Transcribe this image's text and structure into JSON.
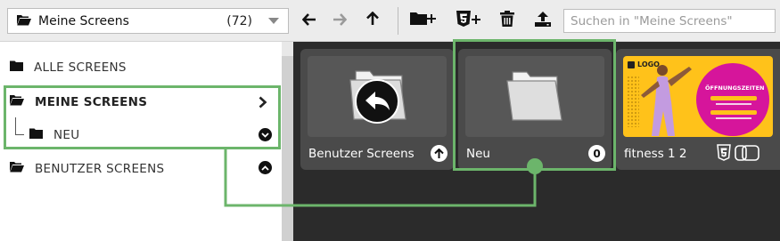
{
  "toolbar": {
    "folder_select": {
      "label": "Meine Screens",
      "count": "(72)"
    },
    "buttons": {
      "back": "arrow-left-icon",
      "forward": "arrow-right-icon",
      "up": "arrow-up-icon",
      "new_folder": "folder-plus-icon",
      "new_html5": "html5-plus-icon",
      "delete": "trash-icon",
      "upload": "upload-icon"
    },
    "search": {
      "placeholder": "Suchen in \"Meine Screens\"",
      "value": ""
    }
  },
  "sidebar": {
    "items": [
      {
        "label": "ALLE SCREENS"
      },
      {
        "label": "MEINE SCREENS"
      },
      {
        "label": "NEU"
      },
      {
        "label": "BENUTZER SCREENS"
      }
    ]
  },
  "cards": [
    {
      "title": "Benutzer Screens",
      "type": "folder-up"
    },
    {
      "title": "Neu",
      "badge": "0",
      "type": "folder"
    },
    {
      "title": "fitness 1 2",
      "type": "html5-screen",
      "thumb_logo": "LOGO",
      "thumb_heading": "ÖFFNUNGSZEITEN"
    }
  ],
  "colors": {
    "highlight": "#6cb56b",
    "content_bg": "#2b2b2b",
    "card_bg": "#4a4a4a",
    "thumb_yellow": "#ffc21a",
    "thumb_magenta": "#d6159b"
  }
}
